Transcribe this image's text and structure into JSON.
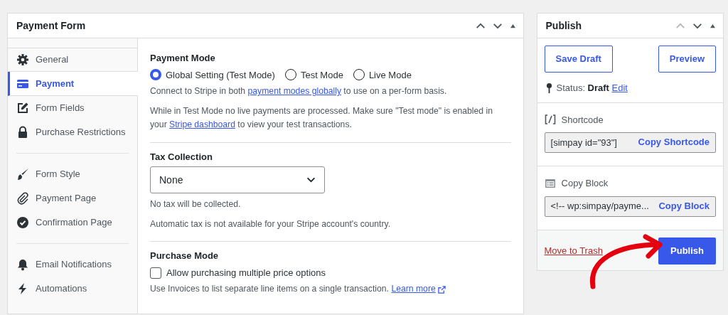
{
  "form_panel": {
    "title": "Payment Form",
    "move_up_disabled": false,
    "sidebar": {
      "groups": [
        [
          {
            "label": "General",
            "selected": false
          },
          {
            "label": "Payment",
            "selected": true
          },
          {
            "label": "Form Fields",
            "selected": false
          },
          {
            "label": "Purchase Restrictions",
            "selected": false
          }
        ],
        [
          {
            "label": "Form Style",
            "selected": false
          },
          {
            "label": "Payment Page",
            "selected": false
          },
          {
            "label": "Confirmation Page",
            "selected": false
          }
        ],
        [
          {
            "label": "Email Notifications",
            "selected": false
          },
          {
            "label": "Automations",
            "selected": false
          }
        ]
      ]
    },
    "sections": [
      {
        "heading": "Payment Mode",
        "kind": "radios",
        "options": [
          {
            "label": "Global Setting (Test Mode)",
            "selected": true
          },
          {
            "label": "Test Mode",
            "selected": false
          },
          {
            "label": "Live Mode",
            "selected": false
          }
        ],
        "notes": [
          [
            {
              "kind": "text",
              "text": "Connect to Stripe in both "
            },
            {
              "kind": "link",
              "text": "payment modes globally"
            },
            {
              "kind": "text",
              "text": " to use on a per-form basis."
            }
          ],
          [
            {
              "kind": "text",
              "text": "While in Test Mode no live payments are processed. Make sure \"Test mode\" is enabled in your "
            },
            {
              "kind": "link",
              "text": "Stripe dashboard"
            },
            {
              "kind": "text",
              "text": " to view your test transactions."
            }
          ]
        ]
      },
      {
        "heading": "Tax Collection",
        "kind": "select",
        "value": "None",
        "notes": [
          [
            {
              "kind": "text",
              "text": "No tax will be collected."
            }
          ],
          [
            {
              "kind": "text",
              "text": "Automatic tax is not available for your Stripe account's country."
            }
          ]
        ]
      },
      {
        "heading": "Purchase Mode",
        "kind": "checkbox",
        "label": "Allow purchasing multiple price options",
        "checked": false,
        "notes": [
          [
            {
              "kind": "text",
              "text": "Use Invoices to list separate line items on a single transaction. "
            },
            {
              "kind": "external_link",
              "text": "Learn more"
            }
          ]
        ]
      }
    ]
  },
  "publish_panel": {
    "title": "Publish",
    "move_up_disabled": true,
    "buttons": [
      "Save Draft",
      "Preview"
    ],
    "status": {
      "label": "Status:",
      "value": "Draft",
      "link": "Edit"
    },
    "copy_fields": [
      {
        "label": "Shortcode",
        "value": "[simpay id=\"93\"]",
        "button": "Copy Shortcode"
      },
      {
        "label": "Copy Block",
        "value": "<!-- wp:simpay/payme...",
        "button": "Copy Block"
      }
    ],
    "trash_link": "Move to Trash",
    "publish_button": "Publish"
  }
}
